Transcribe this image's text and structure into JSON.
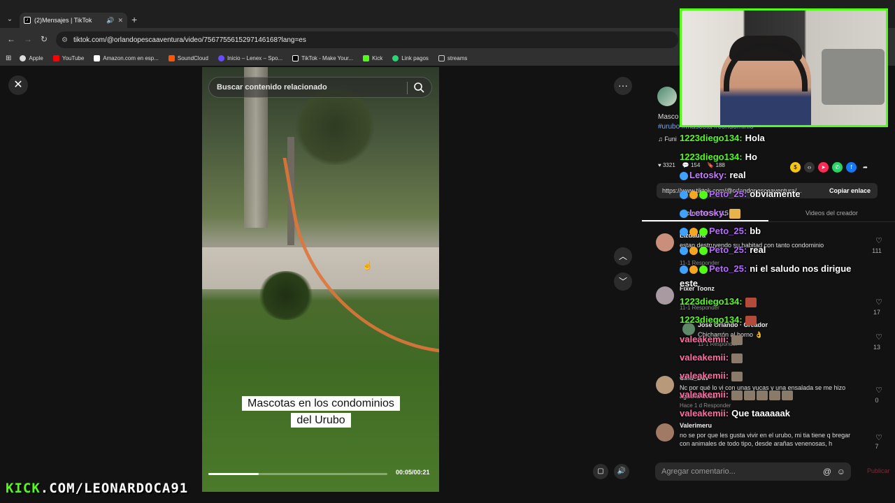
{
  "browser": {
    "tab_title": "(2)Mensajes | TikTok",
    "url": "tiktok.com/@orlandopescaaventura/video/7567755615297146168?lang=es",
    "bookmarks": [
      {
        "label": "Apple",
        "color": "#dddddd"
      },
      {
        "label": "YouTube",
        "color": "#ff0000"
      },
      {
        "label": "Amazon.com en esp...",
        "color": "#ffffff"
      },
      {
        "label": "SoundCloud",
        "color": "#ff5500"
      },
      {
        "label": "Inicio – Lenex – Spo...",
        "color": "#6a4cff"
      },
      {
        "label": "TikTok - Make Your...",
        "color": "#000000"
      },
      {
        "label": "Kick",
        "color": "#53fc18"
      },
      {
        "label": "Link pagos",
        "color": "#2bd576"
      },
      {
        "label": "streams",
        "color": "#cccccc"
      }
    ]
  },
  "video": {
    "search_placeholder": "Buscar contenido relacionado",
    "caption_line1": "Mascotas en los condominios",
    "caption_line2": "del Urubo",
    "time": "00:05/00:21",
    "progress": 0.28
  },
  "post": {
    "desc": "Masco",
    "tags": "#urubo #mascota #condominio",
    "music": "Funi",
    "likes": "3321",
    "comments_count": "154",
    "saves": "188",
    "link": "https://www.tiktok.com/@orlandopescaaventura/...",
    "copy_label": "Copiar enlace",
    "tab_comments": "Comentarios (15",
    "tab_creator": "Videos del creador"
  },
  "comments": [
    {
      "name": "Lizdaura",
      "text": "estan destruyendo su habitad con tanto condominio",
      "meta": "11-1   Responder",
      "likes": "111",
      "avatar": "#c98f7a"
    },
    {
      "name": "Fixer Toonz",
      "text": "",
      "meta": "11-1   Responder",
      "likes": "17",
      "avatar": "#a89aa0"
    },
    {
      "name": "Jose Orlando · Creador",
      "text": "Chicharrón al horno 👌",
      "meta": "11-1   Responder",
      "likes": "13",
      "avatar": "#5e8a6a"
    },
    {
      "name": "Cinti_Dav",
      "text": "Nc por qué lo vi con unas yucas y una ensalada se me hizo agua la boca",
      "meta": "Hace 1 d   Responder",
      "likes": "0",
      "avatar": "#b89a7a"
    },
    {
      "name": "Valerimeru",
      "text": "no se por que les gusta vivir en el urubo, mi tia tiene q bregar con animales de todo tipo, desde arañas venenosas, h",
      "meta": "",
      "likes": "7",
      "avatar": "#a07a64"
    }
  ],
  "comment_input": {
    "placeholder": "Agregar comentario...",
    "publish": "Publicar"
  },
  "chat": [
    {
      "user": "1223diego134:",
      "msg": "Hola",
      "color": "#53fc18"
    },
    {
      "user": "1223diego134:",
      "msg": "Ho",
      "color": "#53fc18"
    },
    {
      "user": "Letosky:",
      "msg": "real",
      "color": "#c77dff"
    },
    {
      "user": "Peto_25:",
      "msg": "obviamente",
      "color": "#b56cff"
    },
    {
      "user": "Letosky:",
      "msg": "",
      "color": "#c77dff"
    },
    {
      "user": "Peto_25:",
      "msg": "bb",
      "color": "#b56cff"
    },
    {
      "user": "Peto_25:",
      "msg": "real",
      "color": "#b56cff"
    },
    {
      "user": "Peto_25:",
      "msg": "ni el saludo nos dirigue",
      "color": "#b56cff"
    },
    {
      "user": "este",
      "msg": "",
      "color": "#ffffff"
    },
    {
      "user": "1223diego134:",
      "msg": "",
      "color": "#53fc18"
    },
    {
      "user": "1223diego134:",
      "msg": "",
      "color": "#53fc18"
    },
    {
      "user": "valeakemii:",
      "msg": "",
      "color": "#ff6fa5"
    },
    {
      "user": "valeakemii:",
      "msg": "",
      "color": "#ff6fa5"
    },
    {
      "user": "valeakemii:",
      "msg": "",
      "color": "#ff6fa5"
    },
    {
      "user": "valeakemii:",
      "msg": "",
      "color": "#ff6fa5"
    },
    {
      "user": "valeakemii:",
      "msg": "Que taaaaaak",
      "color": "#ff6fa5"
    }
  ],
  "brand": {
    "k_part": "KICK",
    "rest": ".COM/LEONARDOCA91"
  }
}
